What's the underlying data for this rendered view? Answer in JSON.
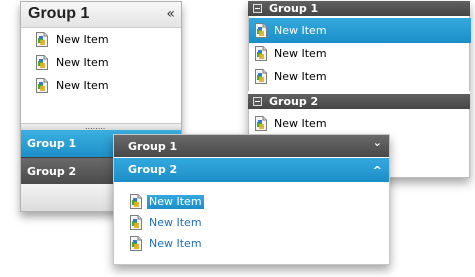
{
  "panel_a": {
    "title": "Group 1",
    "collapse_glyph": "«",
    "items": [
      "New Item",
      "New Item",
      "New Item"
    ],
    "splitter_grip": "........",
    "groups": [
      "Group 1",
      "Group 2"
    ]
  },
  "panel_b": {
    "group1": "Group 1",
    "group1_items": [
      "New Item",
      "New Item",
      "New Item"
    ],
    "group2": "Group 2",
    "group2_items": [
      "New Item"
    ]
  },
  "panel_c": {
    "group1": "Group 1",
    "group1_chevron": "⌄",
    "group2": "Group 2",
    "group2_chevron": "^",
    "items": [
      "New Item",
      "New Item",
      "New Item"
    ]
  },
  "colors": {
    "selected_blue": "#1b8ec8",
    "header_gray": "#4a4a4a",
    "link_blue": "#1f6fb8"
  },
  "icons": {
    "item": "document-icon",
    "collapse": "double-chevron-left-icon",
    "expand_collapse": "minus-box-icon"
  }
}
